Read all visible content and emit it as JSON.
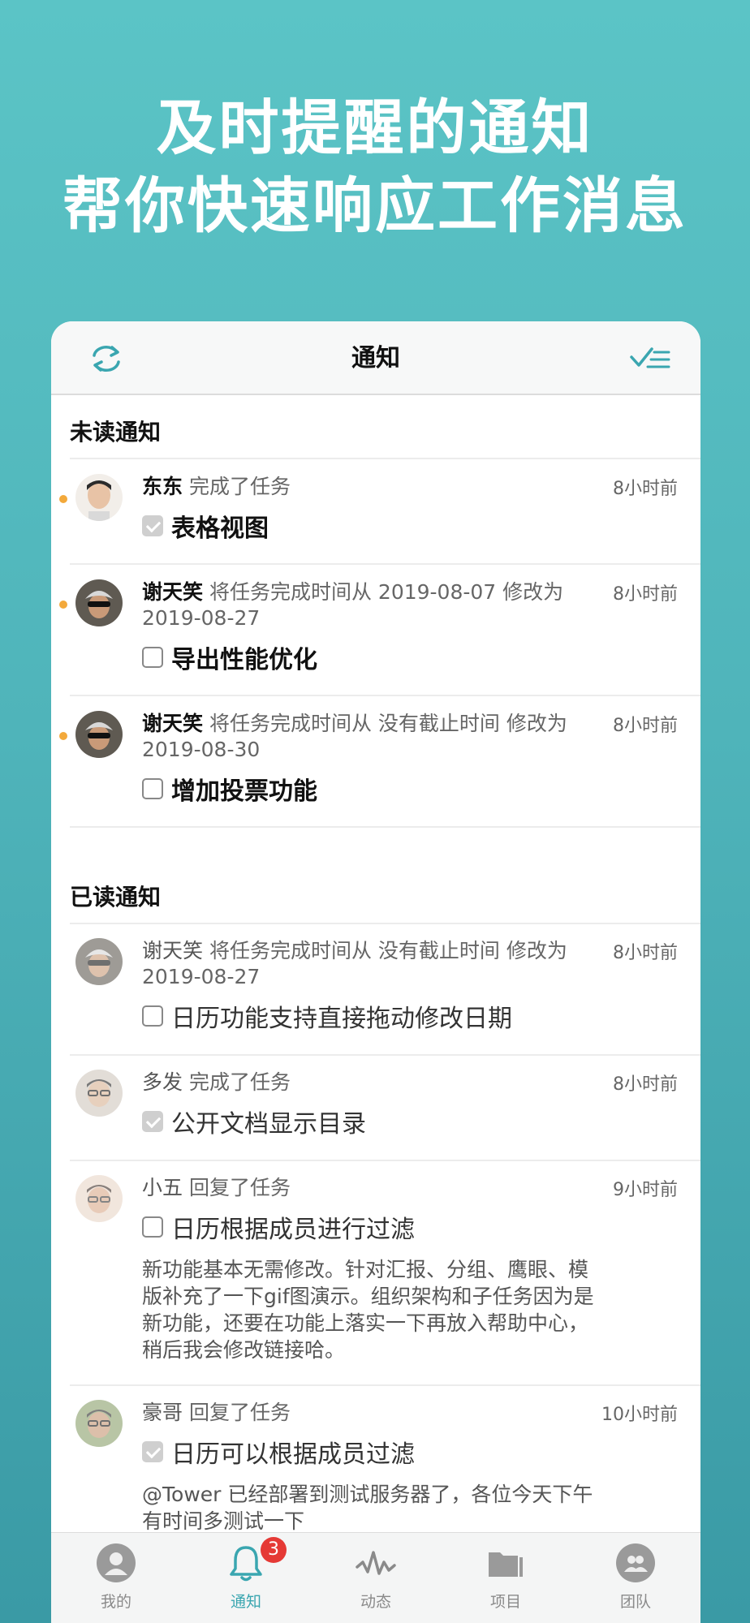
{
  "hero": {
    "line1": "及时提醒的通知",
    "line2": "帮你快速响应工作消息"
  },
  "nav": {
    "title": "通知",
    "left_icon": "refresh-icon",
    "right_icon": "mark-all-read-icon"
  },
  "colors": {
    "accent": "#3aa6b0",
    "unread_dot": "#f3a93b",
    "badge": "#e53935"
  },
  "unread": {
    "title": "未读通知",
    "items": [
      {
        "actor": "东东",
        "action": " 完成了任务",
        "time": "8小时前",
        "task": "表格视图",
        "checked": true
      },
      {
        "actor": "谢天笑",
        "action": " 将任务完成时间从 2019-08-07 修改为 2019-08-27",
        "time": "8小时前",
        "task": "导出性能优化",
        "checked": false
      },
      {
        "actor": "谢天笑",
        "action": " 将任务完成时间从 没有截止时间 修改为 2019-08-30",
        "time": "8小时前",
        "task": "增加投票功能",
        "checked": false
      }
    ]
  },
  "read": {
    "title": "已读通知",
    "items": [
      {
        "actor": "谢天笑",
        "action": " 将任务完成时间从 没有截止时间 修改为 2019-08-27",
        "time": "8小时前",
        "task": "日历功能支持直接拖动修改日期",
        "checked": false
      },
      {
        "actor": "多发",
        "action": " 完成了任务",
        "time": "8小时前",
        "task": "公开文档显示目录",
        "checked": true
      },
      {
        "actor": "小五",
        "action": " 回复了任务",
        "time": "9小时前",
        "task": "日历根据成员进行过滤",
        "checked": false,
        "comment": "新功能基本无需修改。针对汇报、分组、鹰眼、模版补充了一下gif图演示。组织架构和子任务因为是新功能，还要在功能上落实一下再放入帮助中心，稍后我会修改链接哈。"
      },
      {
        "actor": "豪哥",
        "action": " 回复了任务",
        "time": "10小时前",
        "task": "日历可以根据成员过滤",
        "checked": true,
        "comment": "@Tower 已经部署到测试服务器了，各位今天下午有时间多测试一下"
      }
    ]
  },
  "tabbar": {
    "items": [
      {
        "label": "我的",
        "icon": "profile-icon"
      },
      {
        "label": "通知",
        "icon": "bell-icon",
        "badge": "3",
        "active": true
      },
      {
        "label": "动态",
        "icon": "activity-icon"
      },
      {
        "label": "项目",
        "icon": "folder-icon"
      },
      {
        "label": "团队",
        "icon": "team-icon"
      }
    ]
  }
}
